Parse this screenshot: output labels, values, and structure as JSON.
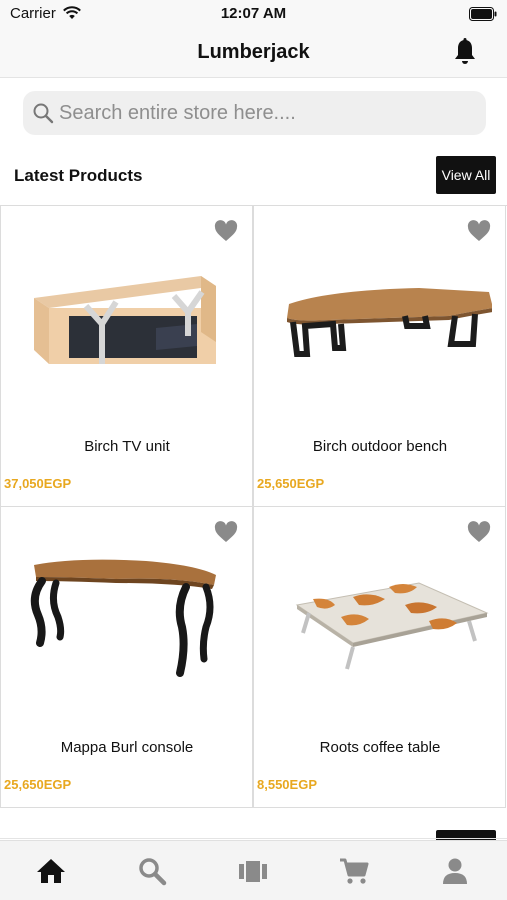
{
  "status_bar": {
    "carrier": "Carrier",
    "time": "12:07 AM",
    "icons": [
      "wifi-icon",
      "battery-icon"
    ]
  },
  "nav": {
    "title": "Lumberjack",
    "right_icon": "bell-icon"
  },
  "search": {
    "placeholder": "Search entire store here....",
    "value": ""
  },
  "section": {
    "title": "Latest Products",
    "view_all_label": "View All"
  },
  "products": [
    {
      "name": "Birch TV unit",
      "price": "37,050EGP",
      "image": "tv-unit-image"
    },
    {
      "name": "Birch outdoor bench",
      "price": "25,650EGP",
      "image": "bench-image"
    },
    {
      "name": "Mappa Burl console",
      "price": "25,650EGP",
      "image": "console-image"
    },
    {
      "name": "Roots coffee table",
      "price": "8,550EGP",
      "image": "coffee-table-image"
    }
  ],
  "tab_bar": {
    "active": "home",
    "tabs": [
      "home-icon",
      "search-icon",
      "categories-icon",
      "cart-icon",
      "profile-icon"
    ]
  },
  "colors": {
    "price": "#e8a820",
    "accent_dark": "#111111",
    "tab_active": "#111111",
    "tab_inactive": "#8a8a8a",
    "heart": "#8a8a8a"
  }
}
